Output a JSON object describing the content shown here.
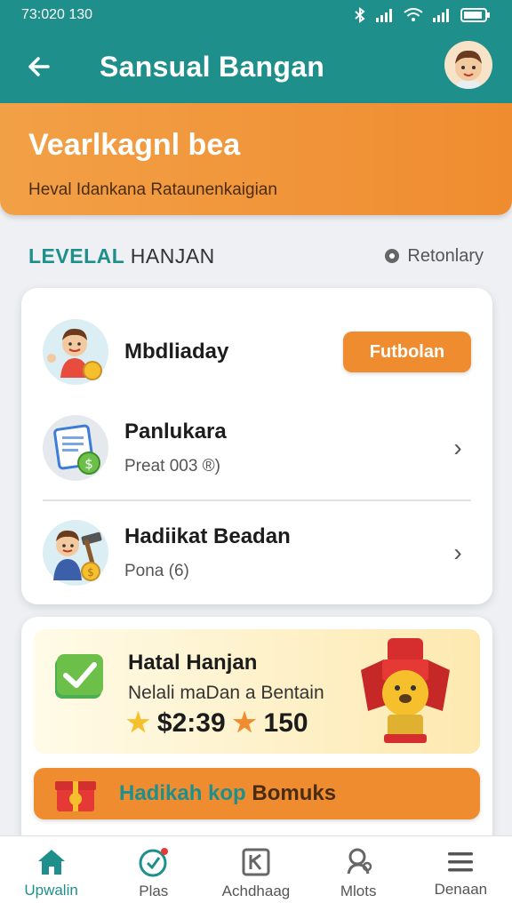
{
  "status_bar": {
    "time": "73:020 130"
  },
  "app_bar": {
    "title": "Sansual Bangan"
  },
  "banner": {
    "title": "Vearlkagnl bea",
    "subtitle": "Heval Idankana Rataunenkaigian"
  },
  "section": {
    "title_accent": "LEVELAL",
    "title_rest": "HANJAN",
    "link_label": "Retonlary"
  },
  "list": [
    {
      "name": "Mbdliaday",
      "action_label": "Futbolan"
    },
    {
      "name": "Panlukara",
      "meta": "Preat 003 ®)"
    },
    {
      "name": "Hadiikat Beadan",
      "meta": "Pona (6)"
    }
  ],
  "reward": {
    "title": "Hatal Hanjan",
    "subtitle": "Nelali maDan a Bentain",
    "value_money": "$2:39",
    "value_points": "150",
    "star_color_1": "#f5c02b",
    "star_color_2": "#f08c30"
  },
  "bonus_button": {
    "label_part1": "Hadikah kop",
    "label_part2": "Bomuks"
  },
  "nav": [
    {
      "label": "Upwalin",
      "icon": "home-icon"
    },
    {
      "label": "Plas",
      "icon": "play-icon"
    },
    {
      "label": "Achdhaag",
      "icon": "card-icon"
    },
    {
      "label": "Mlots",
      "icon": "badge-icon"
    },
    {
      "label": "Denaan",
      "icon": "menu-icon"
    }
  ],
  "colors": {
    "primary": "#1f8f8c",
    "accent": "#f08c30"
  }
}
